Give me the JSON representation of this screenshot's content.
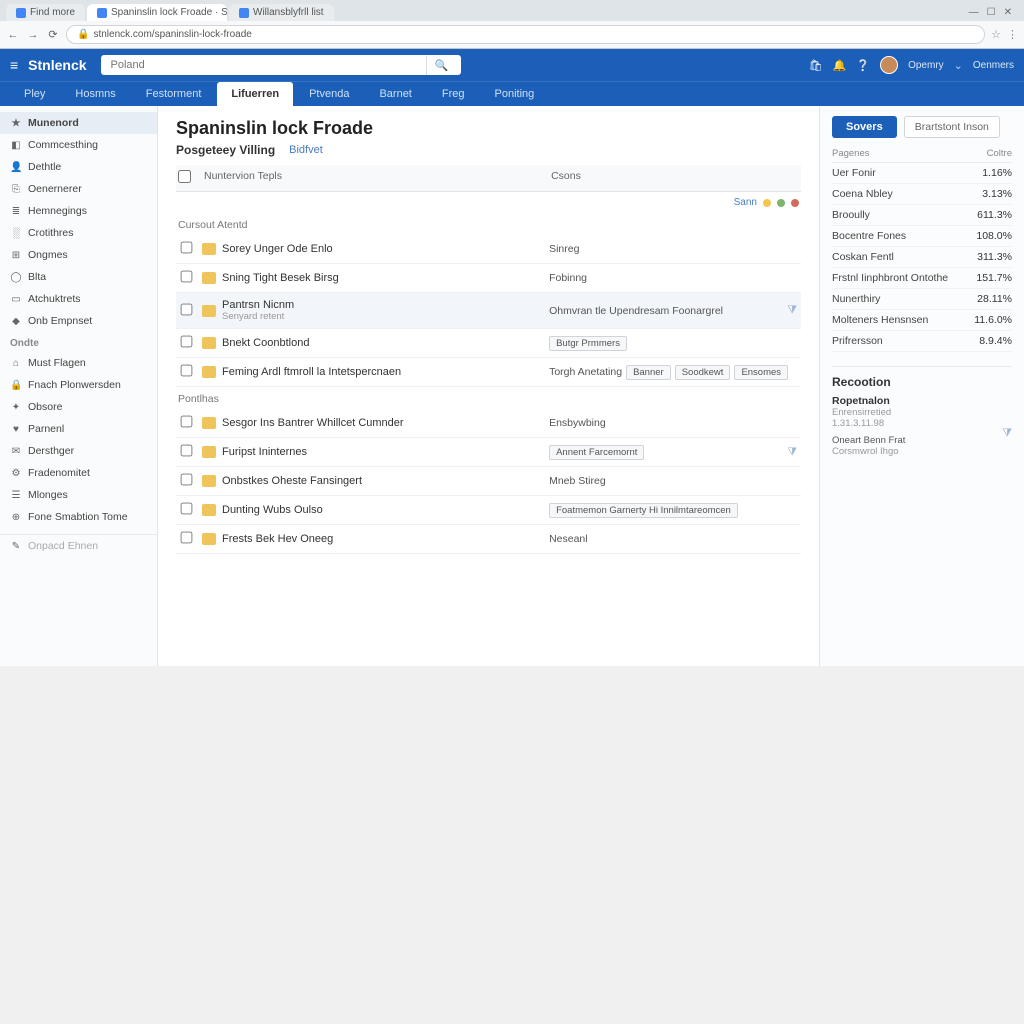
{
  "browser": {
    "tabs": [
      {
        "title": "Find more"
      },
      {
        "title": "Spaninslin lock Froade · Stnlenck"
      },
      {
        "title": "Willansblyfrll list"
      }
    ],
    "address": "stnlenck.com/spaninslin-lock-froade"
  },
  "topbar": {
    "brand": "Stnlenck",
    "search_placeholder": "Poland",
    "uplink": "Opemry",
    "comm": "Oenmers"
  },
  "navbar": {
    "tabs": [
      {
        "label": "Pley"
      },
      {
        "label": "Hosmns"
      },
      {
        "label": "Festorment"
      },
      {
        "label": "Lifuerren",
        "active": true
      },
      {
        "label": "Ptvenda"
      },
      {
        "label": "Barnet"
      },
      {
        "label": "Freg"
      },
      {
        "label": "Poniting"
      }
    ]
  },
  "sidebar": {
    "items": [
      {
        "icon": "★",
        "label": "Munenord",
        "active": true
      },
      {
        "icon": "◧",
        "label": "Commcesthing"
      },
      {
        "icon": "👤",
        "label": "Dethtle"
      },
      {
        "icon": "⎘",
        "label": "Oenernerer"
      },
      {
        "icon": "≣",
        "label": "Hemnegings"
      },
      {
        "icon": "░",
        "label": "Crotithres"
      },
      {
        "icon": "⊞",
        "label": "Ongmes"
      },
      {
        "icon": "◯",
        "label": "Blta"
      },
      {
        "icon": "▭",
        "label": "Atchuktrets"
      },
      {
        "icon": "◆",
        "label": "Onb Empnset"
      }
    ],
    "heading2": "Ondte",
    "items2": [
      {
        "icon": "⌂",
        "label": "Must Flagen"
      },
      {
        "icon": "🔒",
        "label": "Fnach Plonwersden"
      },
      {
        "icon": "✦",
        "label": "Obsore"
      },
      {
        "icon": "♥",
        "label": "Parnenl"
      },
      {
        "icon": "✉",
        "label": "Dersthger"
      },
      {
        "icon": "⚙",
        "label": "Fradenomitet"
      },
      {
        "icon": "☰",
        "label": "Mlonges"
      },
      {
        "icon": "⊕",
        "label": "Fone Smabtion Tome"
      }
    ],
    "footer_input": "Onpacd Ehnen"
  },
  "main": {
    "title": "Spaninslin lock Froade",
    "subtitle": "Posgeteey Villing",
    "sublink": "Bidfvet",
    "col_name": "Nuntervion Tepls",
    "col_status": "Csons",
    "status_text": "Sann",
    "section1": "Cursout Atentd",
    "section2": "Pontlhas",
    "rows1": [
      {
        "name": "Sorey Unger Ode Enlo",
        "status": "Sinreg"
      },
      {
        "name": "Sning Tight Besek Birsg",
        "status": "Fobinng"
      },
      {
        "name": "Pantrsn Nicnm",
        "sub": "Senyard retent",
        "status": "Ohmvran tle Upendresam Foonargrel",
        "hl": true,
        "filter": true
      },
      {
        "name": "Bnekt Coonbtlond",
        "status_pill": "Butgr Prmmers"
      },
      {
        "name": "Feming Ardl ftmroll la Intetspercnaen",
        "status": "Torgh Anetating",
        "status_pills": [
          "Banner",
          "Soodkewt",
          "Ensomes"
        ]
      }
    ],
    "rows2": [
      {
        "name": "Sesgor Ins Bantrer Whillcet Cumnder",
        "status": "Ensbywbing"
      },
      {
        "name": "Furipst Ininternes",
        "status_pill": "Annent Farcemornt",
        "filter": true
      },
      {
        "name": "Onbstkes Oheste Fansingert",
        "status": "Mneb Stireg"
      },
      {
        "name": "Dunting Wubs Oulso",
        "status_pill": "Foatmemon Garnerty Hi Innilmtareomcen"
      },
      {
        "name": "Frests Bek Hev Oneeg",
        "status": "Neseanl"
      }
    ]
  },
  "right": {
    "save_label": "Sovers",
    "ghost_label": "Brartstont Inson",
    "stat_cols": [
      "Pagenes",
      "Coltre"
    ],
    "stats": [
      {
        "k": "Uer Fonir",
        "v": "1.16%"
      },
      {
        "k": "Coena Nbley",
        "v": "3.13%"
      },
      {
        "k": "Brooully",
        "v": "611.3%"
      },
      {
        "k": "Bocentre Fones",
        "v": "108.0%"
      },
      {
        "k": "Coskan Fentl",
        "v": "311.3%"
      },
      {
        "k": "Frstnl Iinphbront Ontothe",
        "v": "151.7%"
      },
      {
        "k": "Nunerthiry",
        "v": "28.11%"
      },
      {
        "k": "Molteners Hensnsen",
        "v": "11.6.0%"
      },
      {
        "k": "Prifrersson",
        "v": "8.9.4%"
      }
    ],
    "panel_title": "Recootion",
    "panel_sub": "Ropetnalon",
    "tiny1": "Enrensirretied",
    "tiny2": "1.31.3.11.98",
    "tiny3": "Oneart Benn Frat",
    "tiny4": "Corsmwrol Ihgo"
  }
}
